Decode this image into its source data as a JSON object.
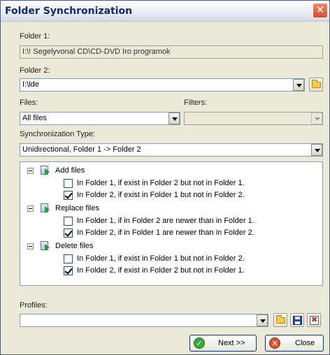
{
  "window": {
    "title": "Folder Synchronization",
    "close_glyph": "✕"
  },
  "folder1": {
    "label": "Folder 1:",
    "value": "I:\\! Segelyvonal CD\\CD-DVD Iro programok"
  },
  "folder2": {
    "label": "Folder 2:",
    "value": "I:\\lde"
  },
  "files": {
    "label": "Files:",
    "value": "All files"
  },
  "filters": {
    "label": "Filters:",
    "value": ""
  },
  "sync_type": {
    "label": "Synchronization Type:",
    "value": "Unidirectional, Folder 1 -> Folder 2"
  },
  "tree": {
    "groups": [
      {
        "label": "Add files",
        "items": [
          {
            "label": "In Folder 1, if exist in Folder 2 but not in Folder 1.",
            "checked": false
          },
          {
            "label": "In Folder 2, if exist in Folder 1 but not in Folder 2.",
            "checked": true
          }
        ]
      },
      {
        "label": "Replace files",
        "items": [
          {
            "label": "In Folder 1, if in Folder 2 are newer than in Folder 1.",
            "checked": false
          },
          {
            "label": "In Folder 2, if in Folder 1 are newer than in Folder 2.",
            "checked": true
          }
        ]
      },
      {
        "label": "Delete files",
        "items": [
          {
            "label": "In Folder 1, if exist in Folder 1 but not in Folder 2.",
            "checked": false
          },
          {
            "label": "In Folder 2, if exist in Folder 2 but not in Folder 1.",
            "checked": true
          }
        ]
      }
    ]
  },
  "profiles": {
    "label": "Profiles:",
    "value": ""
  },
  "buttons": {
    "next": "Next >>",
    "close": "Close"
  },
  "colors": {
    "next_icon": "#3aa83a",
    "close_icon": "#d9532a",
    "title_text": "#0f2b6b"
  },
  "icons": {
    "browse_folder2": "folder-open-icon",
    "profile_open": "folder-open-icon",
    "profile_save": "floppy-disk-icon",
    "profile_delete": "delete-profile-icon",
    "group": "page-arrow-icon",
    "next": "check-circle-icon",
    "close": "x-circle-icon"
  }
}
